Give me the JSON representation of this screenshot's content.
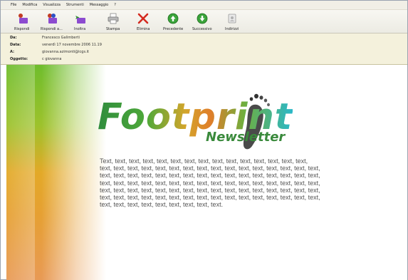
{
  "menu": [
    "File",
    "Modifica",
    "Visualizza",
    "Strumenti",
    "Messaggio",
    "?"
  ],
  "toolbar": [
    {
      "label": "Rispondi",
      "icon": "reply-icon"
    },
    {
      "label": "Rispondi a...",
      "icon": "reply-all-icon"
    },
    {
      "label": "Inoltra",
      "icon": "forward-icon"
    },
    {
      "label": "Stampa",
      "icon": "print-icon"
    },
    {
      "label": "Elimina",
      "icon": "delete-icon"
    },
    {
      "label": "Precedente",
      "icon": "previous-icon"
    },
    {
      "label": "Successivo",
      "icon": "next-icon"
    },
    {
      "label": "Indirizzi",
      "icon": "address-book-icon"
    }
  ],
  "headers": {
    "from_label": "Da:",
    "from_value": "Francesco Galimberti",
    "date_label": "Data:",
    "date_value": "venerdì 17 novembre 2006 11.19",
    "to_label": "A:",
    "to_value": "giovanna.azimonti@icgs.it",
    "subject_label": "Oggetto:",
    "subject_value": "c giovanna"
  },
  "newsletter": {
    "logo_title": "Footprint",
    "logo_subtitle": "Newsletter",
    "body_lines": [
      "Text, text,  text, text, text, text, text, text, text, text, text, text, text, text, text,",
      "text, text, text, text, text, text, text, text, text, text, text, text, text, text, text, text,",
      "text, text, text, text, text, text, text, text, text, text, text, text, text, text, text, text,",
      "text, text, text, text, text, text, text, text, text, text, text, text, text, text, text, text,",
      "text, text, text, text, text, text, text, text, text, text, text, text, text, text, text, text,",
      "text, text, text, text, text, text, text, text, text, text, text, text, text, text, text, text,",
      "text, text, text, text, text, text, text, text, text."
    ]
  },
  "colors": {
    "header_bg": "#f4f1dc",
    "logo_green": "#3a8a3c",
    "logo_orange": "#e07e2a",
    "logo_cyan": "#2ab8c9"
  }
}
